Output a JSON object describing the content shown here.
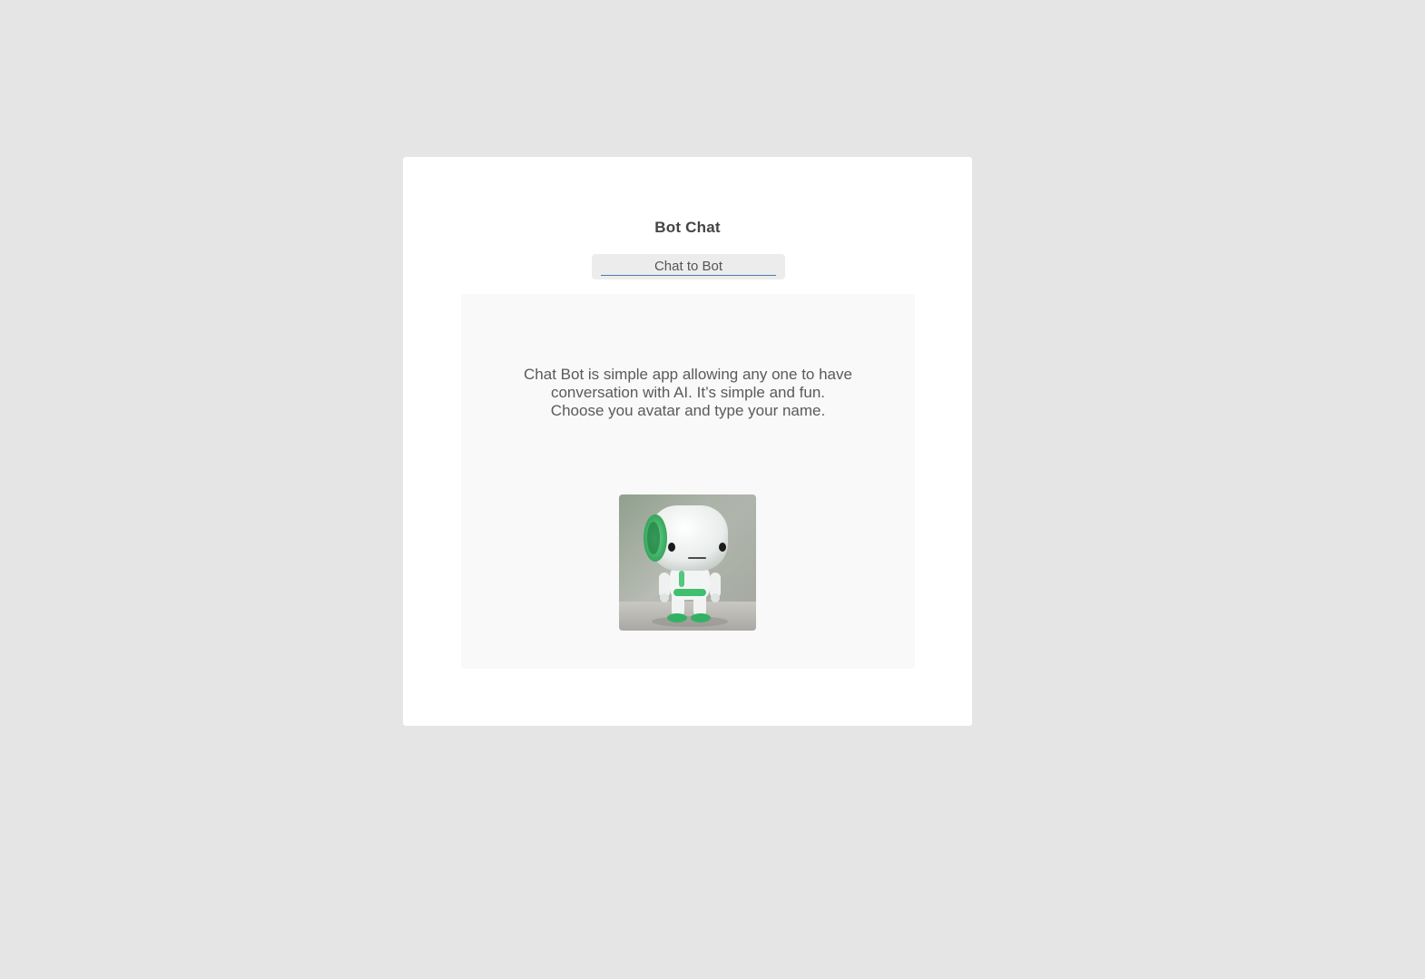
{
  "app": {
    "title": "Bot Chat"
  },
  "header": {
    "chat_button_label": "Chat to Bot"
  },
  "intro": {
    "line1": "Chat Bot is simple app allowing any one to have",
    "line2": "conversation with AI. It’s simple and fun.",
    "line3": "Choose you avatar and type your name."
  },
  "avatar": {
    "icon": "robot-avatar",
    "accent_color": "#3db36b"
  },
  "colors": {
    "page_background": "#e5e5e5",
    "card_background": "#ffffff",
    "panel_background": "#f9f9f9",
    "button_background": "#ececec",
    "button_underline": "#4a7bb0"
  }
}
